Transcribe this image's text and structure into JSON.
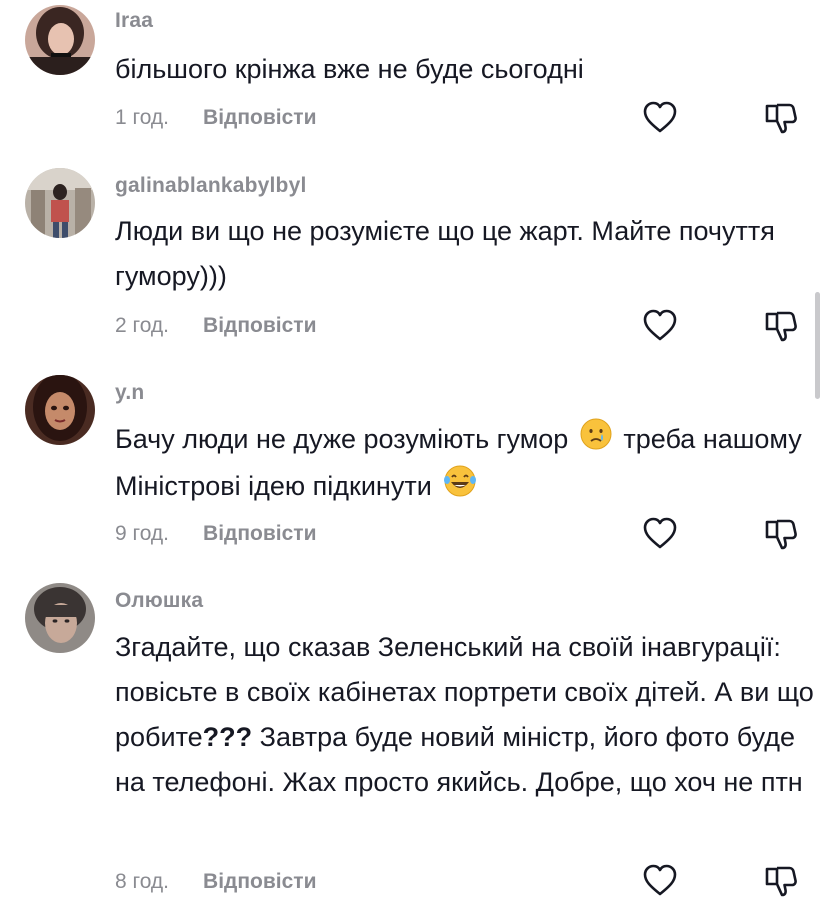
{
  "comments": [
    {
      "username": "Iraa",
      "text": "більшого крінжа вже не буде сьогодні",
      "time": "1 год.",
      "reply": "Відповісти"
    },
    {
      "username": "galinablankabylbyl",
      "text": "Люди ви що не розумієте що це жарт. Майте почуття гумору)))",
      "time": "2 год.",
      "reply": "Відповісти"
    },
    {
      "username": "y.n",
      "text_part1": "Бачу люди не дуже розуміють гумор",
      "text_part2": "треба нашому Міністрові ідею підкинути",
      "emoji1": "crying-face-emoji",
      "emoji2": "laughing-tears-emoji",
      "time": "9 год.",
      "reply": "Відповісти"
    },
    {
      "username": "Олюшка",
      "text_part1": "Згадайте, що сказав Зеленський на своїй інавгурації: повісьте в своїх кабінетах портрети своїх дітей. А ви що робите",
      "text_bold": "???",
      "text_part2": " Завтра буде новий міністр, його фото буде на телефоні. Жах просто якийсь. Добре, що хоч не птн",
      "time": "8 год.",
      "reply": "Відповісти"
    }
  ],
  "icons": {
    "like": "heart-outline-icon",
    "dislike": "thumbs-down-outline-icon"
  },
  "colors": {
    "text": "#161823",
    "muted": "#8a8b91"
  }
}
